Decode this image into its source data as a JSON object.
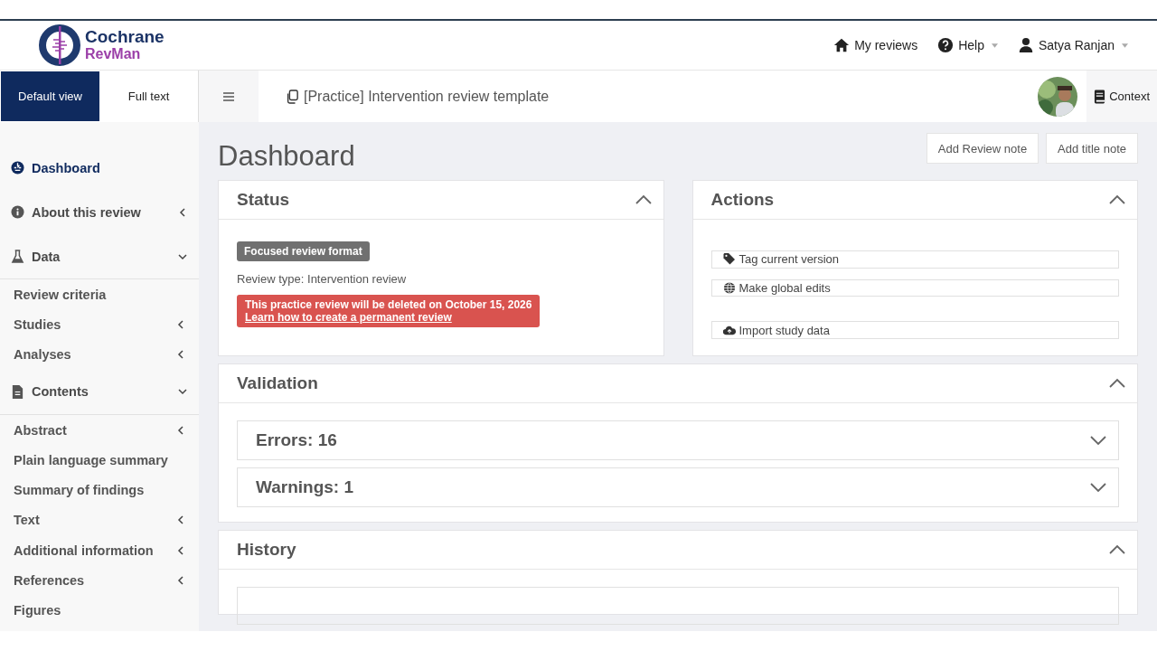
{
  "header": {
    "logo": {
      "name": "Cochrane",
      "product": "RevMan"
    },
    "nav": [
      {
        "label": "My reviews",
        "dropdown": false
      },
      {
        "label": "Help",
        "dropdown": true
      },
      {
        "label": "Satya Ranjan",
        "dropdown": true
      }
    ]
  },
  "view_tabs": [
    {
      "label": "Default view",
      "selected": true
    },
    {
      "label": "Full text",
      "selected": false
    }
  ],
  "review_title": "[Practice] Intervention review template",
  "context_button": "Context",
  "sidebar": {
    "items": [
      {
        "label": "Dashboard",
        "selected": true
      },
      {
        "label": "About this review",
        "selected": false,
        "expanded": false
      },
      {
        "label": "Data",
        "selected": false,
        "expanded": true,
        "children": [
          {
            "label": "Review criteria"
          },
          {
            "label": "Studies",
            "expanded": false
          },
          {
            "label": "Analyses",
            "expanded": false
          }
        ]
      },
      {
        "label": "Contents",
        "selected": false,
        "expanded": true,
        "children": [
          {
            "label": "Abstract",
            "expanded": false
          },
          {
            "label": "Plain language summary"
          },
          {
            "label": "Summary of findings"
          },
          {
            "label": "Text",
            "expanded": false
          },
          {
            "label": "Additional information",
            "expanded": false
          },
          {
            "label": "References",
            "expanded": false
          },
          {
            "label": "Figures"
          }
        ]
      }
    ]
  },
  "page_title": "Dashboard",
  "note_buttons": [
    "Add Review note",
    "Add title note"
  ],
  "status": {
    "title": "Status",
    "expanded": true,
    "badge": "Focused review format",
    "review_type": "Review type: Intervention review",
    "alert": "This practice review will be deleted on October 15, 2026",
    "alert_link": "Learn how to create a permanent review"
  },
  "actions": {
    "title": "Actions",
    "expanded": true,
    "buttons": [
      "Tag current version",
      "Make global edits",
      "Import study data"
    ]
  },
  "validation": {
    "title": "Validation",
    "expanded": true,
    "groups": [
      {
        "label": "Errors: 16",
        "expanded": false
      },
      {
        "label": "Warnings: 1",
        "expanded": false
      }
    ]
  },
  "history": {
    "title": "History",
    "expanded": true
  }
}
